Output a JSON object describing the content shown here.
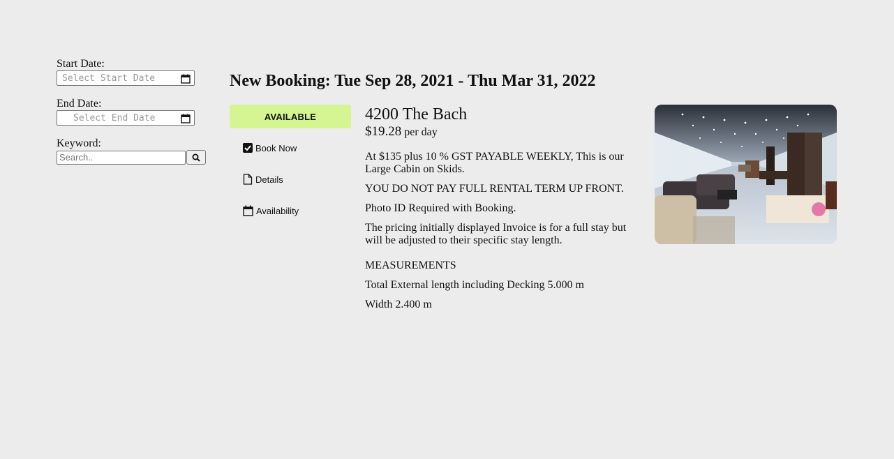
{
  "sidebar": {
    "start_label": "Start Date:",
    "start_placeholder": "Select Start Date",
    "end_label": "End Date:",
    "end_placeholder": "Select End Date",
    "keyword_label": "Keyword:",
    "search_placeholder": "Search.."
  },
  "booking": {
    "heading": "New Booking: Tue Sep 28, 2021 - Thu Mar 31, 2022",
    "status": "AVAILABLE",
    "actions": {
      "book_now": "Book Now",
      "details": "Details",
      "availability": "Availability"
    }
  },
  "listing": {
    "title": "4200 The Bach",
    "price": "$19.28",
    "price_unit": "per day",
    "description": [
      "At $135 plus 10 % GST PAYABLE WEEKLY, This is our Large Cabin on Skids.",
      "YOU DO NOT PAY FULL RENTAL TERM UP FRONT.",
      "Photo ID Required with Booking.",
      "The pricing initially displayed Invoice is for a full stay but will be adjusted to their specific stay length."
    ],
    "measurements_heading": "MEASUREMENTS",
    "measurements": [
      "Total External length including Decking 5.000 m",
      "Width 2.400 m"
    ]
  },
  "colors": {
    "background": "#ececec",
    "available": "#d4f591"
  }
}
